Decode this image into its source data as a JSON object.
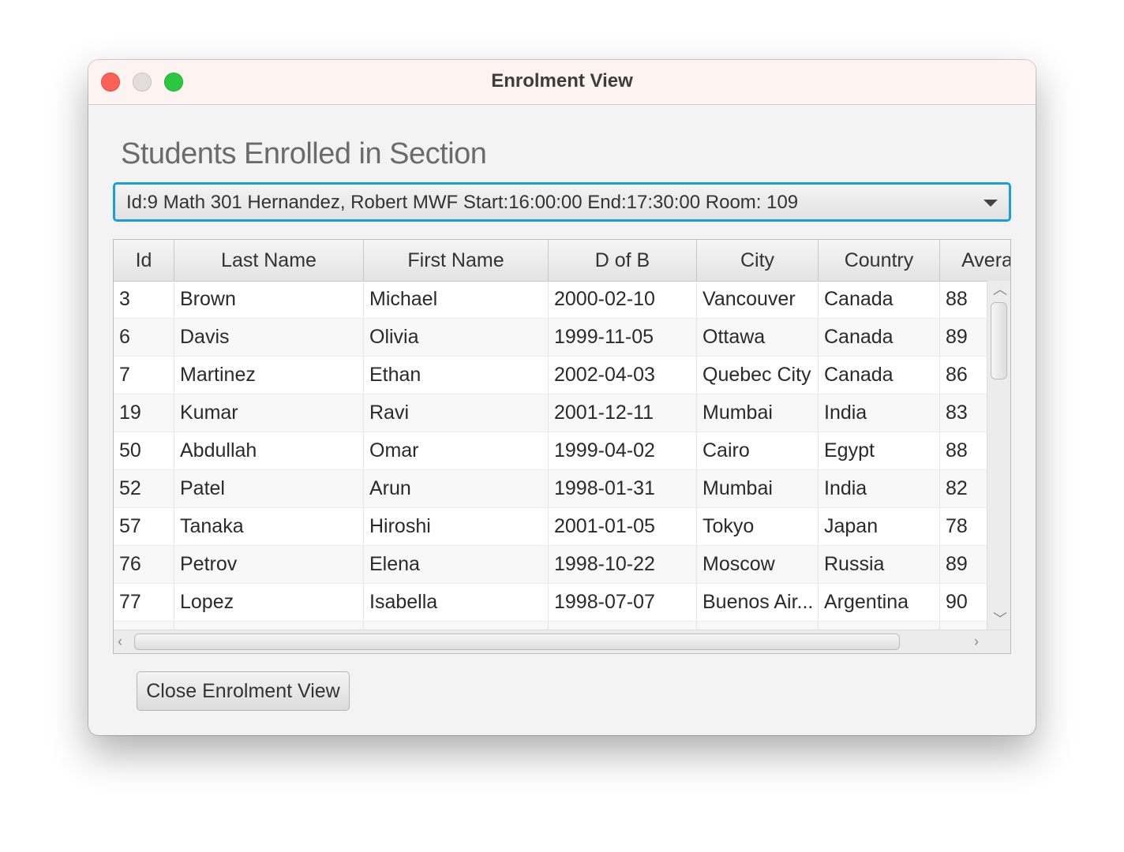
{
  "window": {
    "title": "Enrolment View"
  },
  "heading": "Students Enrolled in Section",
  "section_select": {
    "value": "Id:9 Math 301 Hernandez, Robert MWF Start:16:00:00 End:17:30:00 Room: 109"
  },
  "table": {
    "columns": [
      "Id",
      "Last Name",
      "First Name",
      "D of B",
      "City",
      "Country",
      "Avera"
    ],
    "rows": [
      [
        "3",
        "Brown",
        "Michael",
        "2000-02-10",
        "Vancouver",
        "Canada",
        "88"
      ],
      [
        "6",
        "Davis",
        "Olivia",
        "1999-11-05",
        "Ottawa",
        "Canada",
        "89"
      ],
      [
        "7",
        "Martinez",
        "Ethan",
        "2002-04-03",
        "Quebec City",
        "Canada",
        "86"
      ],
      [
        "19",
        "Kumar",
        "Ravi",
        "2001-12-11",
        "Mumbai",
        "India",
        "83"
      ],
      [
        "50",
        "Abdullah",
        "Omar",
        "1999-04-02",
        "Cairo",
        "Egypt",
        "88"
      ],
      [
        "52",
        "Patel",
        "Arun",
        "1998-01-31",
        "Mumbai",
        "India",
        "82"
      ],
      [
        "57",
        "Tanaka",
        "Hiroshi",
        "2001-01-05",
        "Tokyo",
        "Japan",
        "78"
      ],
      [
        "76",
        "Petrov",
        "Elena",
        "1998-10-22",
        "Moscow",
        "Russia",
        "89"
      ],
      [
        "77",
        "Lopez",
        "Isabella",
        "1998-07-07",
        "Buenos Air...",
        "Argentina",
        "90"
      ],
      [
        "",
        "",
        "",
        "",
        "",
        "",
        ""
      ]
    ]
  },
  "close_button": "Close Enrolment View"
}
